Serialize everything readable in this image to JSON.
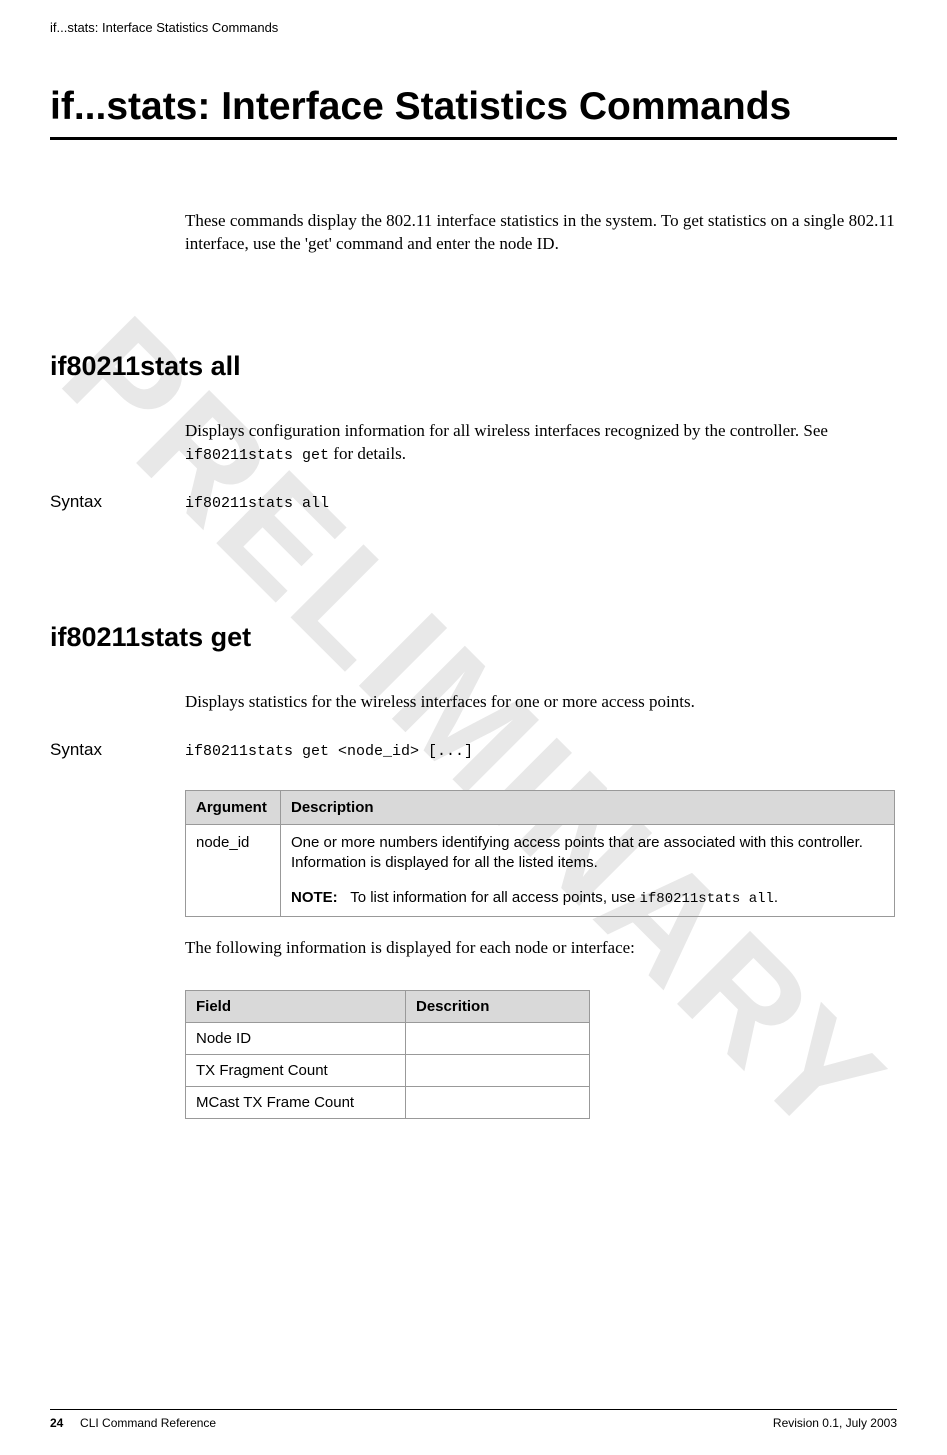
{
  "watermark": "PRELIMINARY",
  "runningHeader": "if...stats: Interface Statistics Commands",
  "mainTitle": "if...stats: Interface Statistics Commands",
  "intro": "These commands display the 802.11 interface statistics in the system. To get statistics on a single 802.11 interface, use the 'get' command and enter the node ID.",
  "section1": {
    "heading": "if80211stats all",
    "desc_pre": "Displays configuration information for all wireless interfaces recognized by the controller. See ",
    "desc_code": "if80211stats get",
    "desc_post": " for details.",
    "syntaxLabel": "Syntax",
    "syntaxCode": "if80211stats all"
  },
  "section2": {
    "heading": "if80211stats get",
    "desc": "Displays statistics for the wireless interfaces for one or more access points.",
    "syntaxLabel": "Syntax",
    "syntaxCode": "if80211stats get <node_id> [...]",
    "argTable": {
      "headers": [
        "Argument",
        "Description"
      ],
      "row": {
        "arg": "node_id",
        "descLine1": "One or more numbers identifying access points that are associated with this controller. Information is displayed for all the listed items.",
        "noteLabel": "NOTE:",
        "noteText1": "To list information for all ",
        "noteSans": "access points",
        "noteText2": ", use ",
        "noteMono": "if80211stats all",
        "noteText3": "."
      }
    },
    "postTable": "The following information is displayed for each node or interface:",
    "fieldTable": {
      "headers": [
        "Field",
        "Descrition"
      ],
      "rows": [
        {
          "field": "Node ID",
          "desc": ""
        },
        {
          "field": "TX Fragment Count",
          "desc": ""
        },
        {
          "field": "MCast TX Frame Count",
          "desc": ""
        }
      ]
    }
  },
  "footer": {
    "pageNum": "24",
    "leftText": "CLI Command Reference",
    "rightText": "Revision 0.1, July 2003"
  }
}
